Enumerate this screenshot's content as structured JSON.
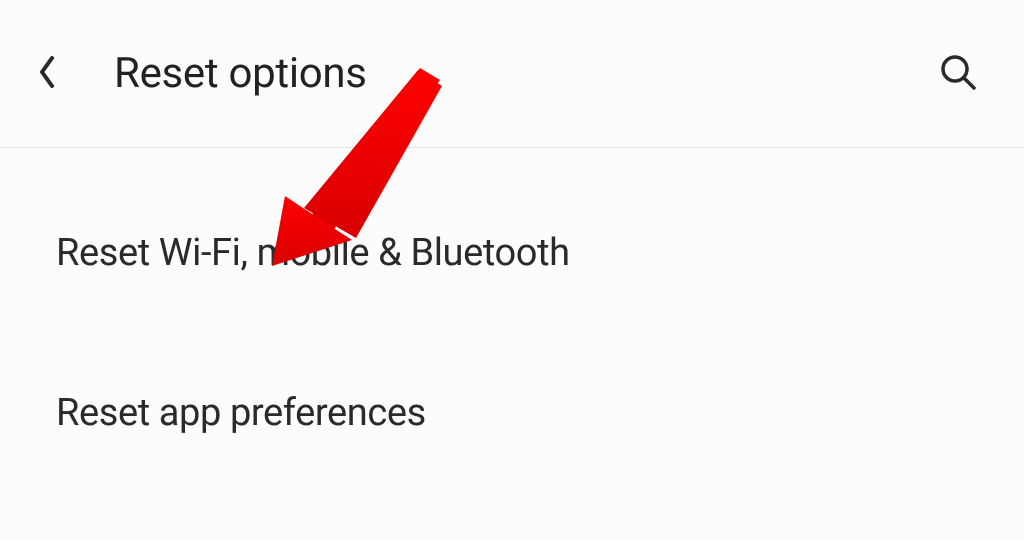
{
  "header": {
    "title": "Reset options"
  },
  "options": {
    "item0": "Reset Wi-Fi, mobile & Bluetooth",
    "item1": "Reset app preferences"
  },
  "annotation": {
    "arrow_color": "#e90000",
    "target": "option-reset-wifi-mobile-bluetooth"
  }
}
